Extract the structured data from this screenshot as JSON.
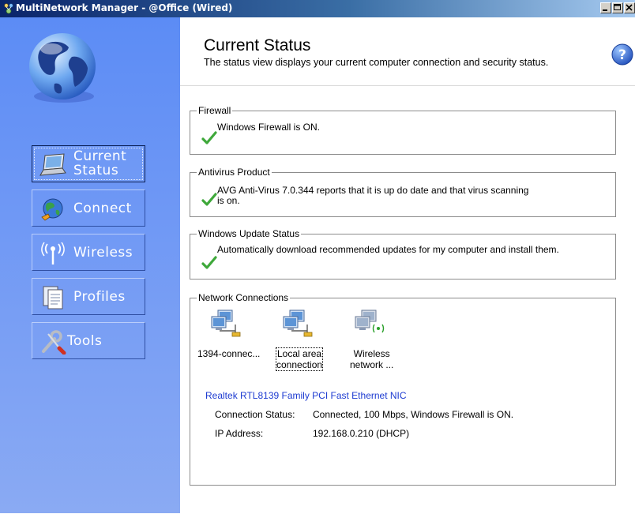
{
  "window": {
    "title": "MultiNetwork Manager - @Office (Wired)"
  },
  "header": {
    "title": "Current Status",
    "subtitle": "The status view displays your current computer connection and security status."
  },
  "sidebar": {
    "items": [
      {
        "label_line1": "Current",
        "label_line2": "Status",
        "icon": "laptop-icon",
        "active": true
      },
      {
        "label": "Connect",
        "icon": "globe-connect-icon",
        "active": false
      },
      {
        "label": "Wireless",
        "icon": "antenna-icon",
        "active": false
      },
      {
        "label": "Profiles",
        "icon": "documents-icon",
        "active": false
      },
      {
        "label": "Tools",
        "icon": "wrench-screwdriver-icon",
        "active": false
      }
    ]
  },
  "sections": {
    "firewall": {
      "legend": "Firewall",
      "message": "Windows Firewall is ON."
    },
    "antivirus": {
      "legend": "Antivirus Product",
      "message_line1": "AVG Anti-Virus 7.0.344 reports that it is up do date and that virus scanning",
      "message_line2": "is on."
    },
    "windows_update": {
      "legend": "Windows Update Status",
      "message": "Automatically download recommended updates for my computer and install them."
    },
    "network": {
      "legend": "Network Connections",
      "connections": [
        {
          "label_line1": "1394-connec...",
          "label_line2": "",
          "icon": "network-connection-icon"
        },
        {
          "label_line1": "Local area",
          "label_line2": "connection",
          "icon": "network-connection-icon",
          "selected": true
        },
        {
          "label_line1": "Wireless",
          "label_line2": "network ...",
          "icon": "wireless-connection-icon"
        }
      ],
      "nic_name": "Realtek RTL8139 Family PCI Fast Ethernet NIC",
      "status_label": "Connection Status:",
      "status_value": "Connected, 100 Mbps, Windows Firewall is ON.",
      "ip_label": "IP Address:",
      "ip_value": "192.168.0.210 (DHCP)"
    }
  },
  "colors": {
    "sidebar": "#6f98f5",
    "titlebar": "#0a246a",
    "link": "#1d3bd1",
    "check": "#3ea83a"
  }
}
